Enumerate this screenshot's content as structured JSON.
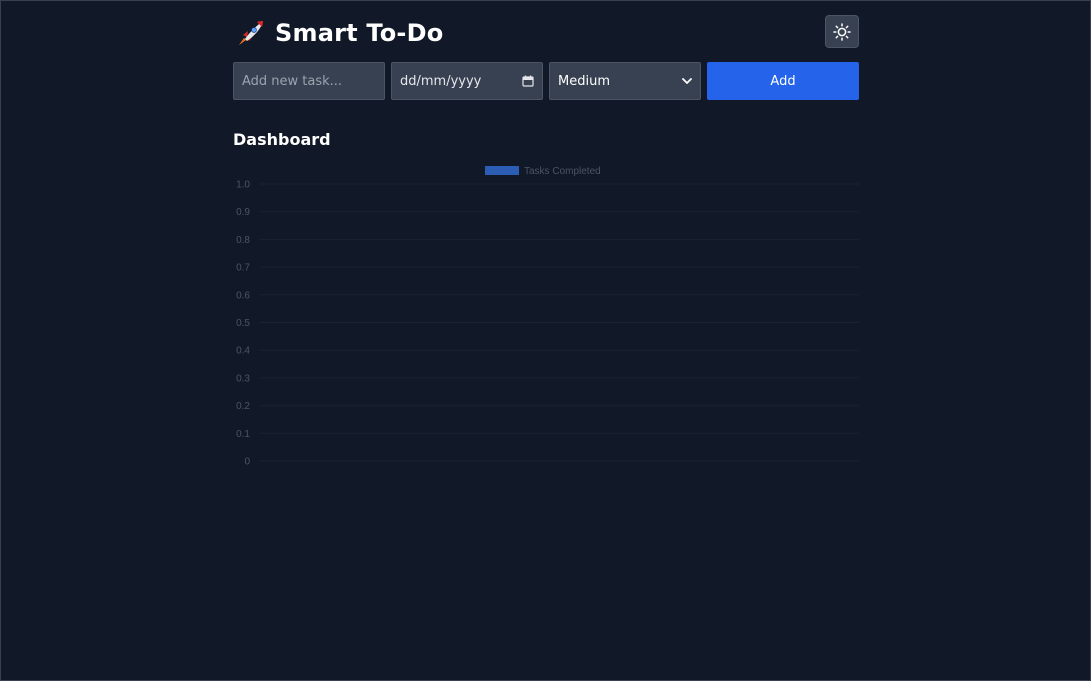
{
  "app": {
    "title": "Smart To-Do",
    "logo_icon": "rocket-icon",
    "theme_toggle_icon": "sun-icon"
  },
  "form": {
    "task_placeholder": "Add new task...",
    "task_value": "",
    "date_placeholder": "dd/mm/yyyy",
    "date_icon": "calendar-icon",
    "priority_selected": "Medium",
    "priority_icon": "chevron-down-icon",
    "add_label": "Add"
  },
  "dashboard": {
    "title": "Dashboard"
  },
  "colors": {
    "background": "#111827",
    "input_bg": "#374151",
    "accent": "#2563eb",
    "series": "#2a5db3",
    "muted_text": "#4b5563"
  },
  "chart_data": {
    "type": "bar",
    "categories": [],
    "series": [
      {
        "name": "Tasks Completed",
        "values": []
      }
    ],
    "ylim": [
      0,
      1
    ],
    "yticks": [
      "1.0",
      "0.9",
      "0.8",
      "0.7",
      "0.6",
      "0.5",
      "0.4",
      "0.3",
      "0.2",
      "0.1",
      "0"
    ],
    "legend": "top-center",
    "grid": true
  }
}
